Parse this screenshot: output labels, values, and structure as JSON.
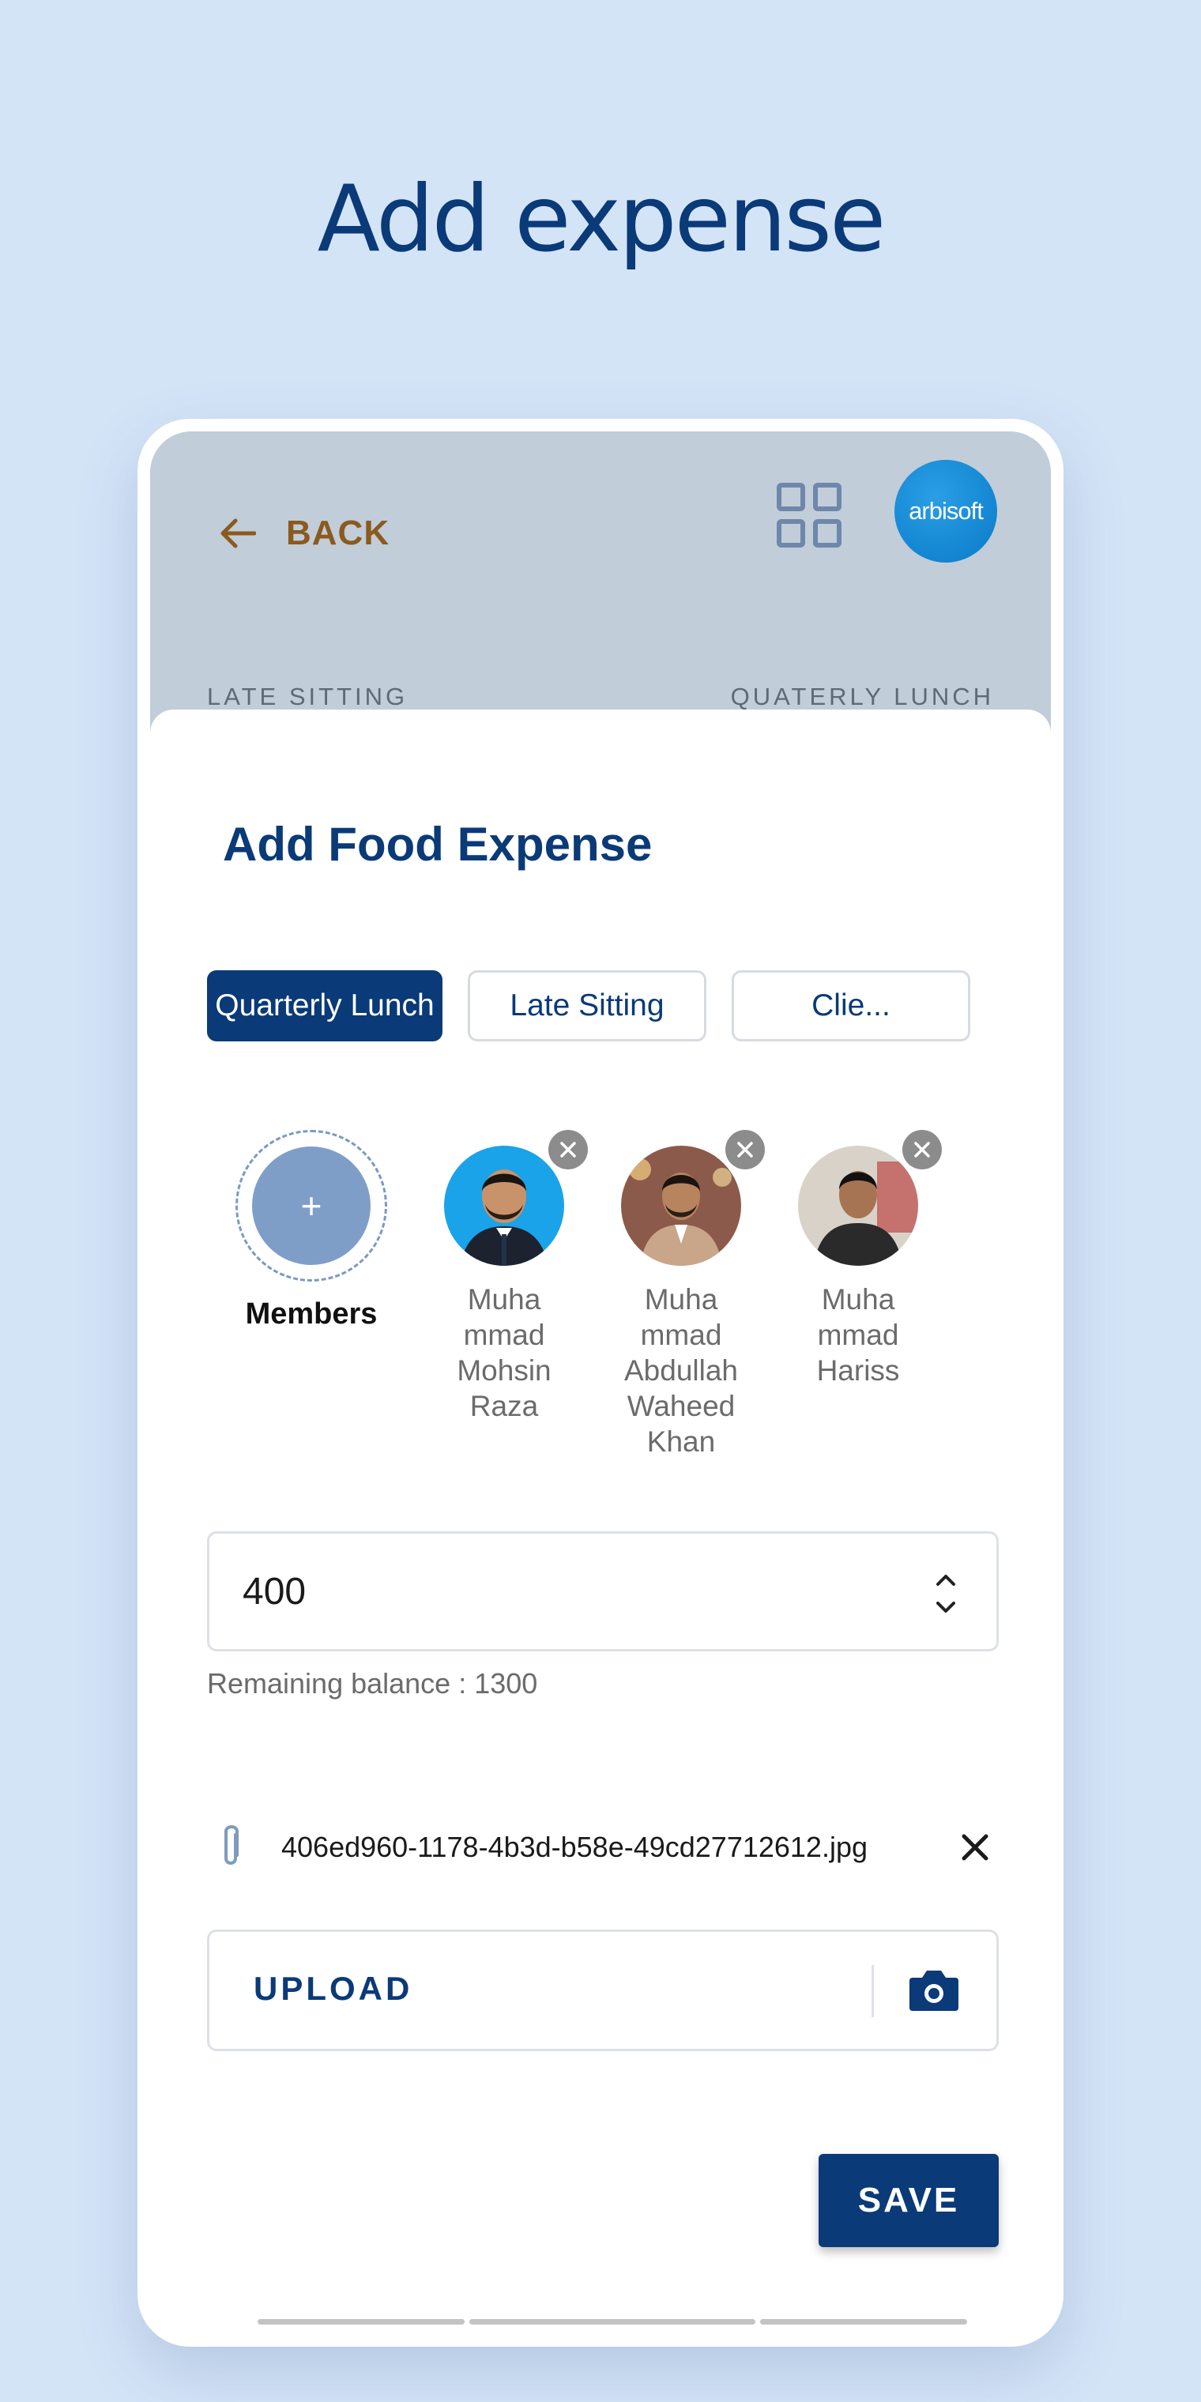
{
  "page_title": "Add expense",
  "header": {
    "back_label": "BACK",
    "logo_text": "arbisoft",
    "tabs": [
      "LATE SITTING",
      "QUATERLY LUNCH"
    ]
  },
  "form": {
    "title": "Add Food Expense",
    "categories": [
      {
        "label": "Quarterly Lunch",
        "selected": true
      },
      {
        "label": "Late Sitting",
        "selected": false
      },
      {
        "label": "Clie...",
        "selected": false
      }
    ],
    "members_label": "Members",
    "add_member_symbol": "+",
    "members": [
      {
        "name": "Muha mmad Mohsin Raza"
      },
      {
        "name": "Muha mmad Abdullah Waheed Khan"
      },
      {
        "name": "Muha mmad Hariss"
      }
    ],
    "amount": "400",
    "remaining_balance": "Remaining balance : 1300",
    "attachment_name": "406ed960-1178-4b3d-b58e-49cd27712612.jpg",
    "upload_label": "UPLOAD",
    "save_label": "SAVE"
  },
  "colors": {
    "background": "#d4e4f7",
    "primary": "#0a3a78",
    "back_accent": "#8a5a1e",
    "header_bg": "#c1cdd8"
  },
  "icons": [
    "back-arrow-icon",
    "grid-icon",
    "remove-icon",
    "chevron-up-icon",
    "chevron-down-icon",
    "paperclip-icon",
    "close-icon",
    "camera-icon"
  ]
}
